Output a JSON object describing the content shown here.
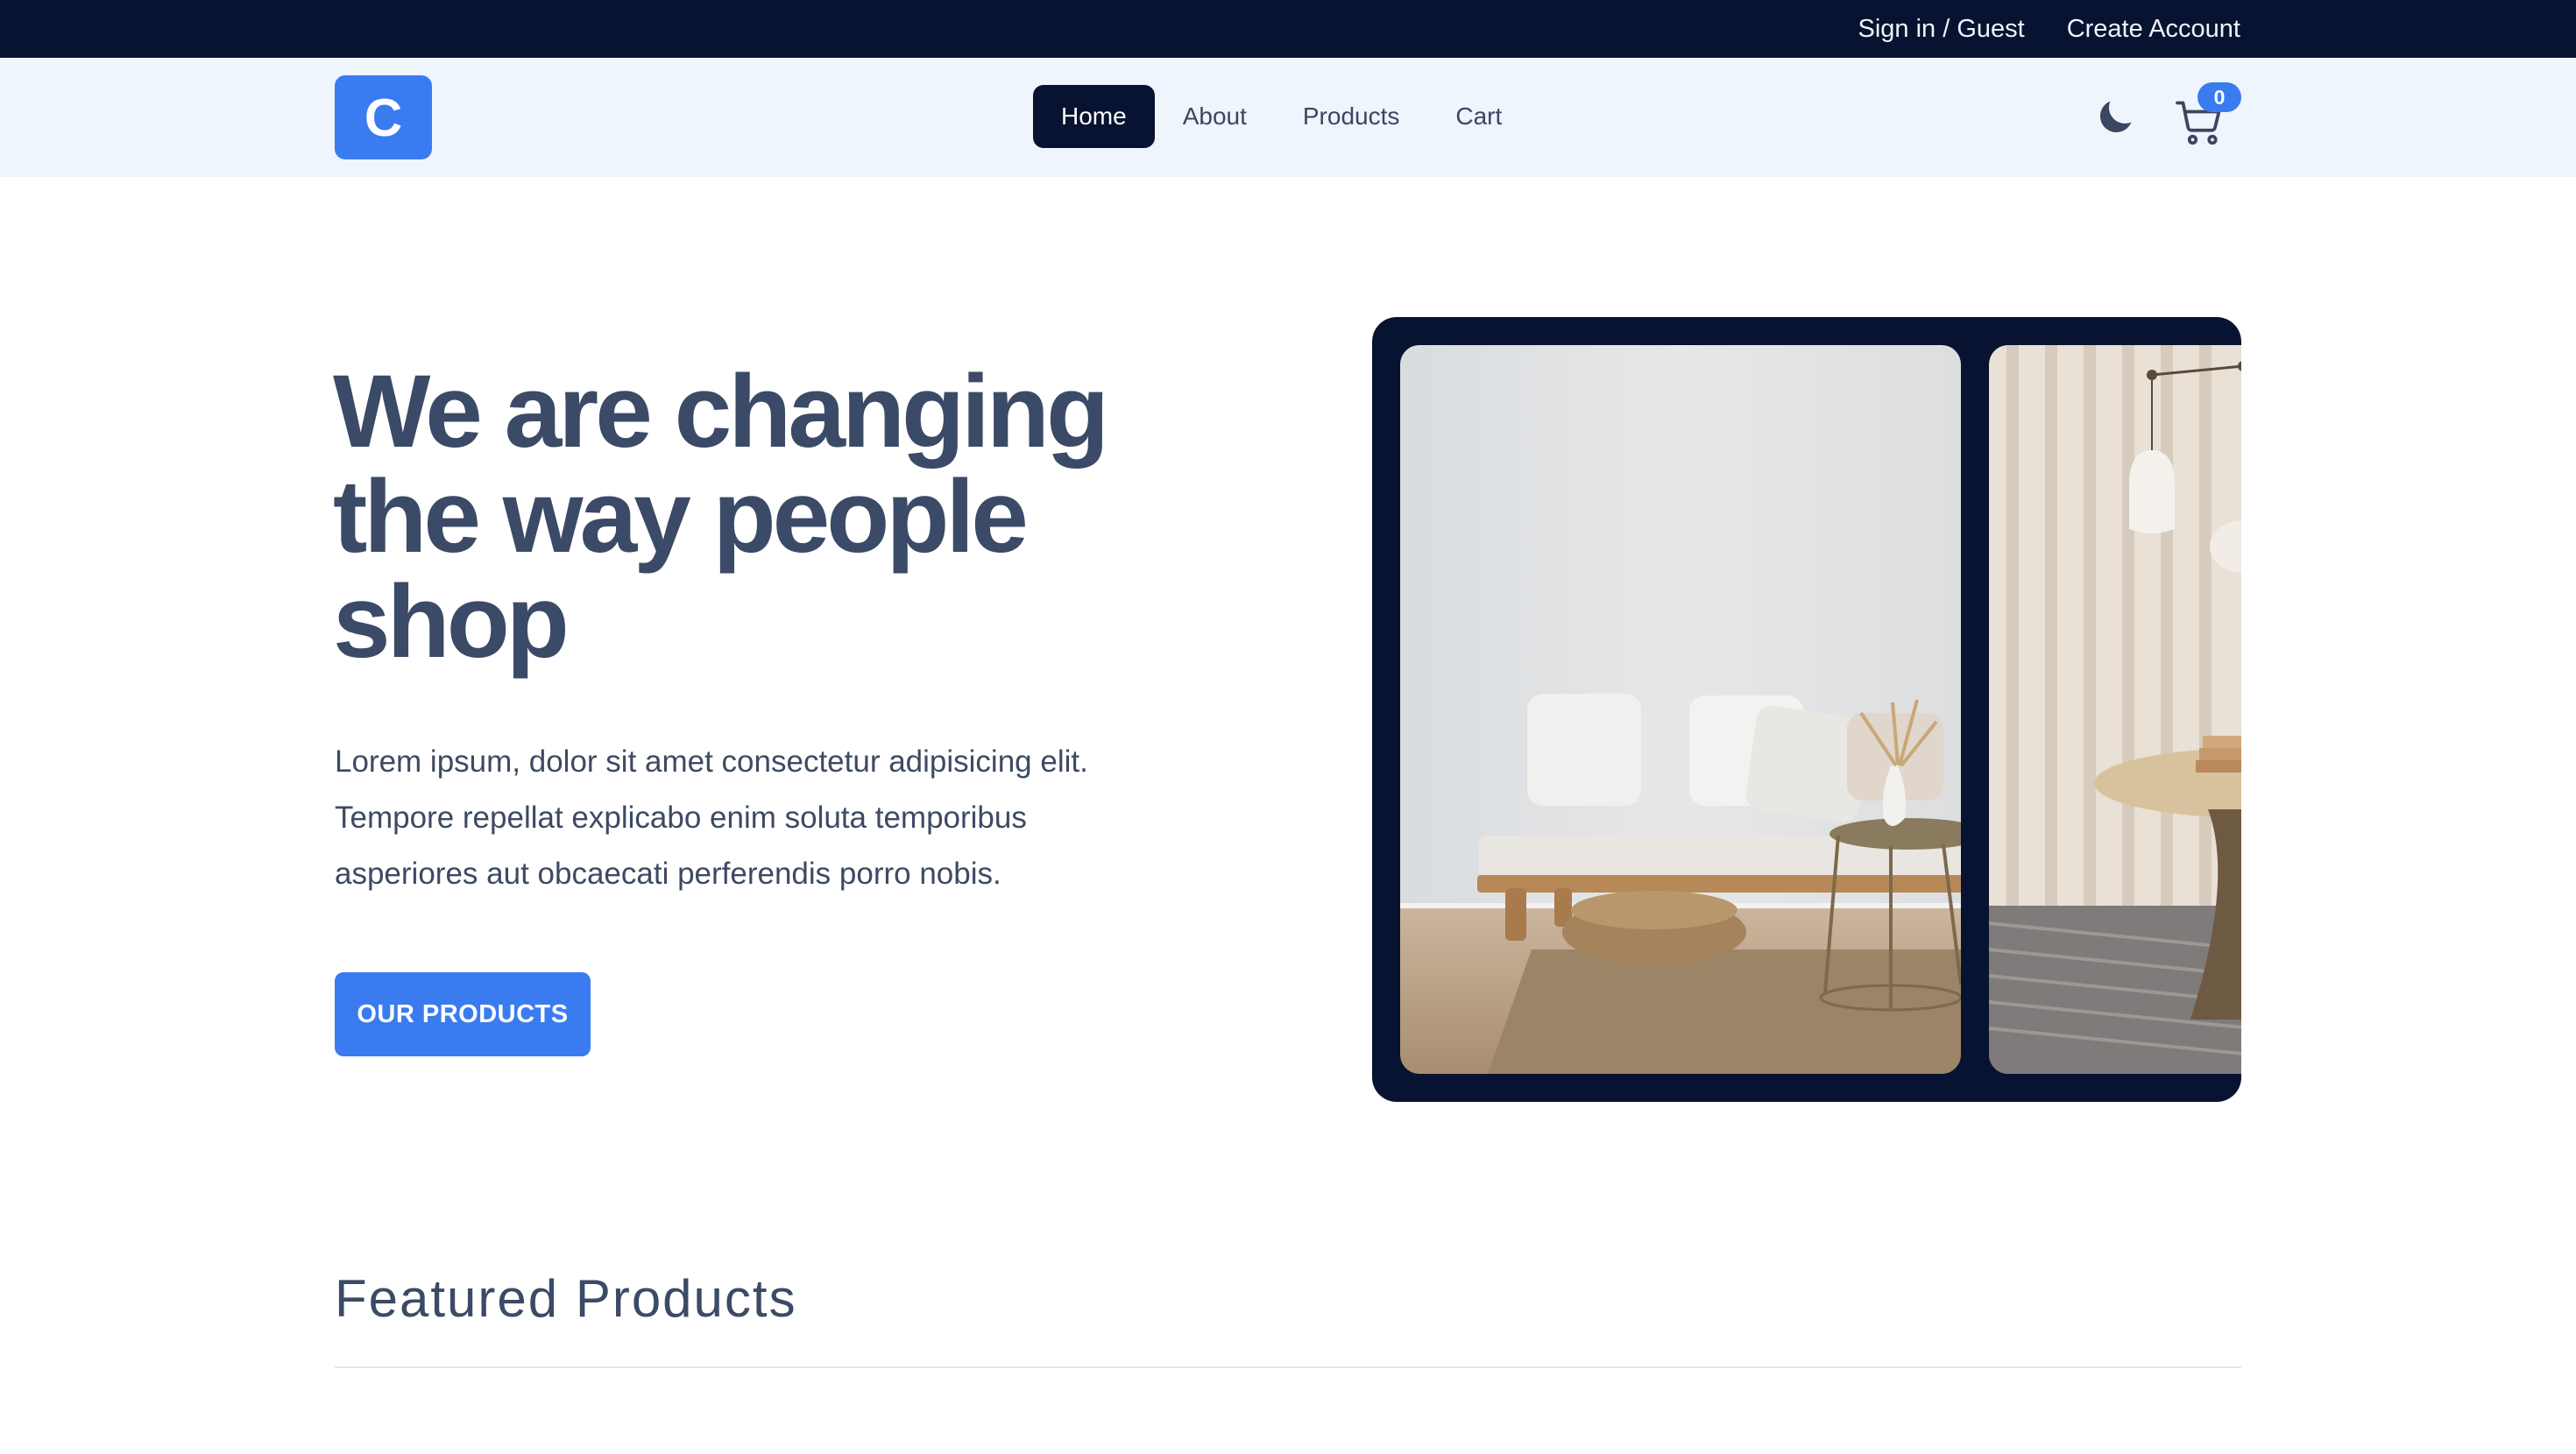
{
  "topbar": {
    "sign_in": "Sign in / Guest",
    "create_account": "Create Account"
  },
  "nav": {
    "logo_letter": "C",
    "links": [
      {
        "label": "Home",
        "active": true
      },
      {
        "label": "About",
        "active": false
      },
      {
        "label": "Products",
        "active": false
      },
      {
        "label": "Cart",
        "active": false
      }
    ],
    "theme_icon": "moon-icon",
    "cart_icon": "cart-icon",
    "cart_count": "0"
  },
  "hero": {
    "title_lines": [
      "We are changing",
      "the way people",
      "shop"
    ],
    "description_lines": [
      "Lorem ipsum, dolor sit amet consectetur adipisicing elit.",
      "Tempore repellat explicabo enim soluta temporibus",
      "asperiores aut obcaecati perferendis porro nobis."
    ],
    "cta_label": "OUR PRODUCTS"
  },
  "featured": {
    "title": "Featured Products"
  },
  "colors": {
    "dark_navy": "#071330",
    "accent_blue": "#3b7bf0",
    "nav_bg": "#eff5fd",
    "heading_text": "#3b4a66"
  }
}
